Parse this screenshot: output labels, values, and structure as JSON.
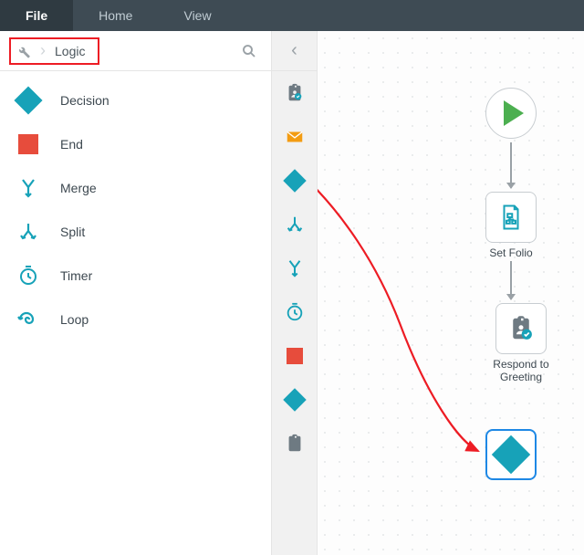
{
  "menu": {
    "items": [
      "File",
      "Home",
      "View"
    ],
    "active": "File"
  },
  "breadcrumb": {
    "category": "Logic"
  },
  "stencils": [
    {
      "name": "Decision",
      "icon": "decision"
    },
    {
      "name": "End",
      "icon": "end"
    },
    {
      "name": "Merge",
      "icon": "merge"
    },
    {
      "name": "Split",
      "icon": "split"
    },
    {
      "name": "Timer",
      "icon": "timer"
    },
    {
      "name": "Loop",
      "icon": "loop"
    }
  ],
  "nodes": {
    "start": {
      "label": ""
    },
    "setFolio": {
      "label": "Set Folio"
    },
    "respond": {
      "label": "Respond to Greeting"
    },
    "decision": {
      "label": ""
    }
  },
  "colors": {
    "teal": "#17a2b8",
    "red": "#e74c3c",
    "orange": "#f39c12",
    "green": "#4CAF50",
    "annotation": "#ed1c24"
  }
}
